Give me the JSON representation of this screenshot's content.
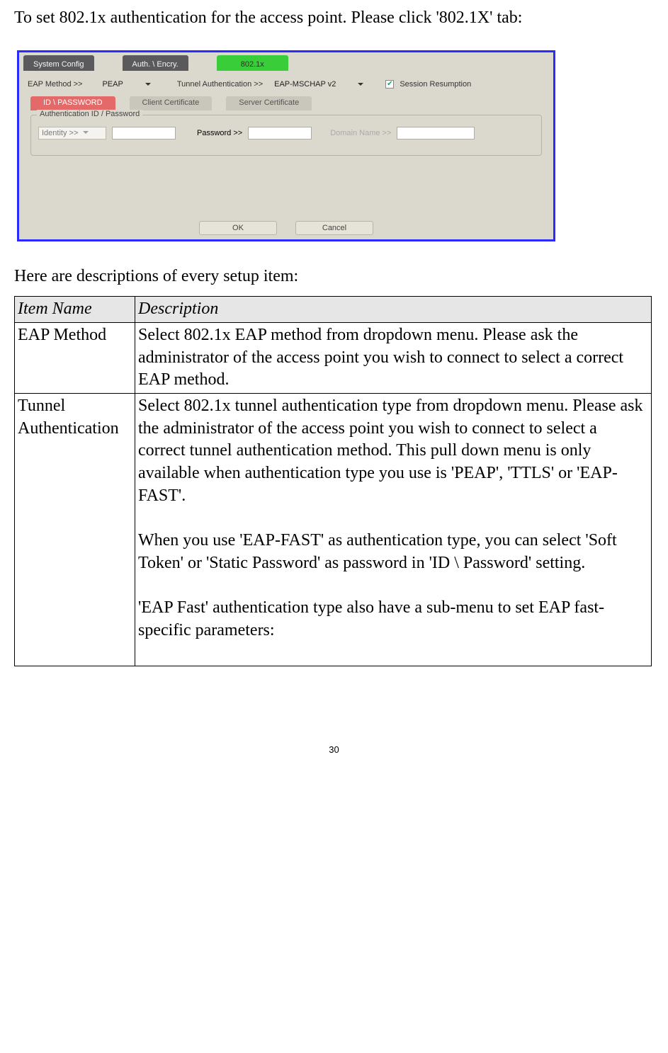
{
  "intro": "To set 802.1x authentication for the access point. Please click '802.1X' tab:",
  "panel": {
    "tabs1": {
      "system": "System Config",
      "auth": "Auth. \\ Encry.",
      "dot1x": "802.1x"
    },
    "eap_label": "EAP Method >>",
    "eap_value": "PEAP",
    "tunnel_label": "Tunnel Authentication >>",
    "tunnel_value": "EAP-MSCHAP v2",
    "session": "Session Resumption",
    "tabs2": {
      "idpw": "ID \\ PASSWORD",
      "client": "Client Certificate",
      "server": "Server Certificate"
    },
    "group_title": "Authentication ID / Password",
    "identity_label": "Identity >>",
    "password_label": "Password >>",
    "domain_label": "Domain Name >>",
    "ok": "OK",
    "cancel": "Cancel"
  },
  "midtext": "Here are descriptions of every setup item:",
  "table": {
    "h1": "Item Name",
    "h2": "Description",
    "r1c1": "EAP Method",
    "r1c2": "Select 802.1x EAP method from dropdown menu. Please ask the administrator of the access point you wish to connect to select a correct EAP method.",
    "r2c1": "Tunnel Authentication",
    "r2c2a": "Select 802.1x tunnel authentication type from dropdown menu. Please ask the administrator of the access point you wish to connect to select a correct tunnel authentication method. This pull down menu is only available when authentication type you use is 'PEAP', 'TTLS' or 'EAP-FAST'.",
    "r2c2b": "When you use 'EAP-FAST' as authentication type, you can select 'Soft Token' or 'Static Password' as password in 'ID \\ Password' setting.",
    "r2c2c": "'EAP Fast' authentication type also have a sub-menu to set EAP fast-specific parameters:"
  },
  "pagenum": "30"
}
